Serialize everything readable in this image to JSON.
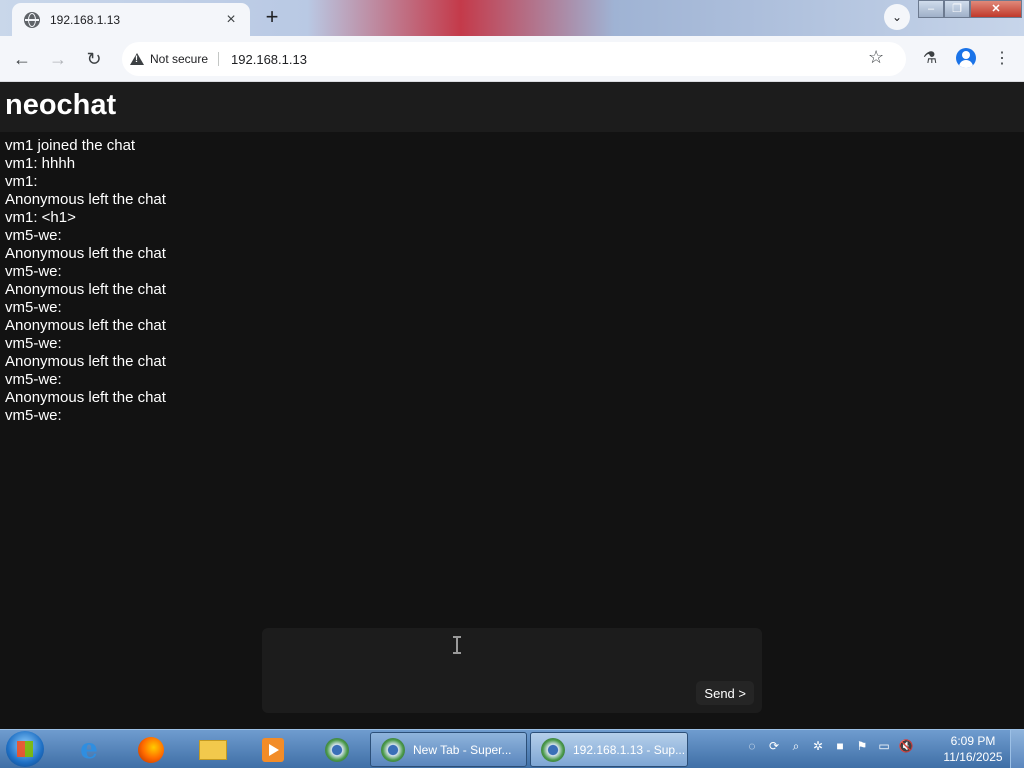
{
  "browser": {
    "tab_title": "192.168.1.13",
    "tab_close": "×",
    "new_tab": "+",
    "tab_search": "⌄",
    "security_label": "Not secure",
    "url": "192.168.1.13",
    "nav_back": "←",
    "nav_forward": "→",
    "reload": "↻",
    "bookmark": "☆",
    "labs": "⚗",
    "menu": "⋮",
    "window_min": "–",
    "window_max": "❐",
    "window_close": "✕"
  },
  "app": {
    "title": "neochat",
    "messages": [
      "vm1 joined the chat",
      "vm1: hhhh",
      "vm1:",
      "Anonymous left the chat",
      "vm1: <h1>",
      "vm5-we:",
      "Anonymous left the chat",
      "vm5-we:",
      "Anonymous left the chat",
      "vm5-we:",
      "Anonymous left the chat",
      "vm5-we:",
      "Anonymous left the chat",
      "vm5-we:",
      "Anonymous left the chat",
      "vm5-we:"
    ],
    "composer": {
      "value": "",
      "send_label": "Send >"
    }
  },
  "taskbar": {
    "pinned": [
      "internet-explorer-icon",
      "firefox-icon",
      "folder-icon",
      "media-player-icon",
      "chrome-icon"
    ],
    "tasks": [
      {
        "label": "New Tab - Super..."
      },
      {
        "label": "192.168.1.13 - Sup..."
      }
    ],
    "tray_icons": [
      "network-icon",
      "update-icon",
      "search-icon",
      "bluetooth-icon",
      "nvidia-icon",
      "flag-icon",
      "display-icon",
      "volume-muted-icon"
    ],
    "time": "6:09 PM",
    "date": "11/16/2025"
  }
}
